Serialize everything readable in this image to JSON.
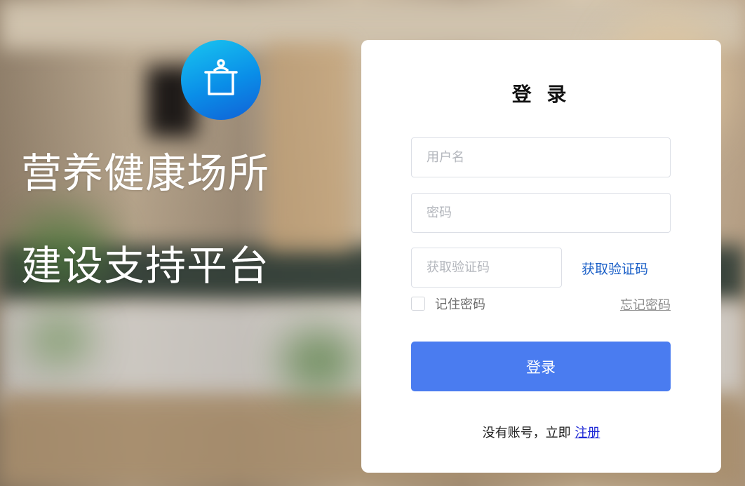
{
  "brand": {
    "slogan_line1": "营养健康场所",
    "slogan_line2": "建设支持平台",
    "logo_icon": "cooking-pot-icon",
    "logo_color": "#0a8ee8"
  },
  "login": {
    "title": "登 录",
    "username_placeholder": "用户名",
    "password_placeholder": "密码",
    "code_placeholder": "获取验证码",
    "get_code_label": "获取验证码",
    "remember_label": "记住密码",
    "forgot_label": "忘记密码",
    "submit_label": "登录",
    "no_account_text": "没有账号，立即 ",
    "register_label": "注册"
  },
  "colors": {
    "primary": "#4a7cf0",
    "link": "#1a5fc7",
    "register_link": "#1d27d6"
  }
}
